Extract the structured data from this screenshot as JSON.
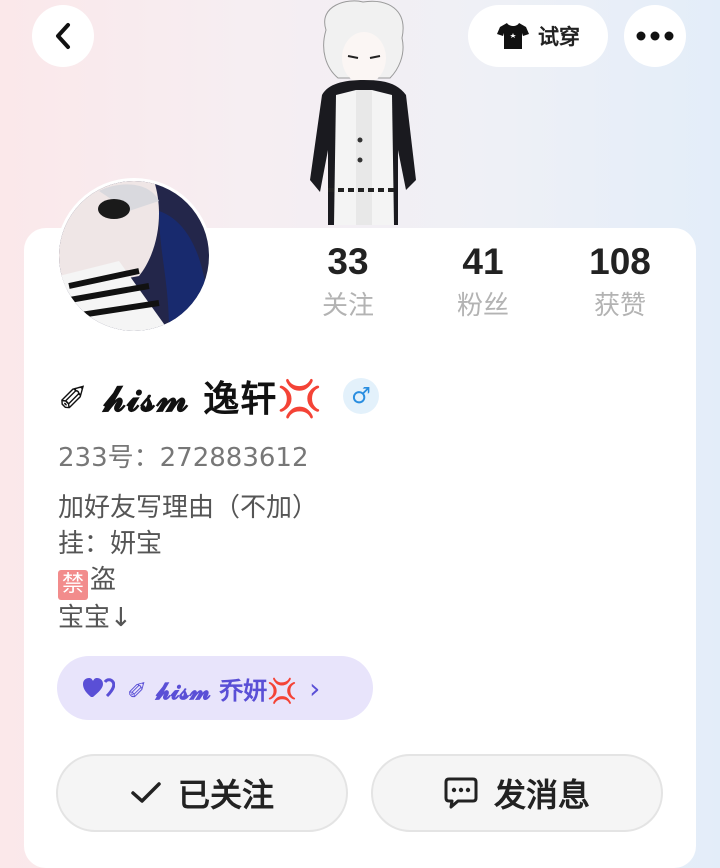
{
  "header": {
    "back_icon": "chevron-left-icon",
    "try_on_label": "试穿",
    "try_on_icon": "tshirt-icon",
    "more_icon": "more-dots-icon"
  },
  "stats": [
    {
      "value": "33",
      "label": "关注"
    },
    {
      "value": "41",
      "label": "粉丝"
    },
    {
      "value": "108",
      "label": "获赞"
    }
  ],
  "profile": {
    "name": "✐ 𝓱𝓲𝓼𝓶 逸轩💢",
    "gender_symbol": "♂",
    "uid": "233号：272883612",
    "bio_lines": [
      "加好友写理由（不加）",
      "挂：妍宝",
      "盗",
      "宝宝↓"
    ],
    "ban_badge": "禁"
  },
  "cp_chip": {
    "label": "✐ 𝓱𝓲𝓼𝓶 乔妍💢",
    "heart_icon": "double-heart-icon",
    "arrow": "›"
  },
  "actions": {
    "follow_label": "已关注",
    "message_label": "发消息"
  },
  "colors": {
    "accent": "#5a4fd6",
    "chip_bg": "#e8e4fb",
    "gender": "#2a8ee0",
    "ban": "#f28c8c"
  }
}
